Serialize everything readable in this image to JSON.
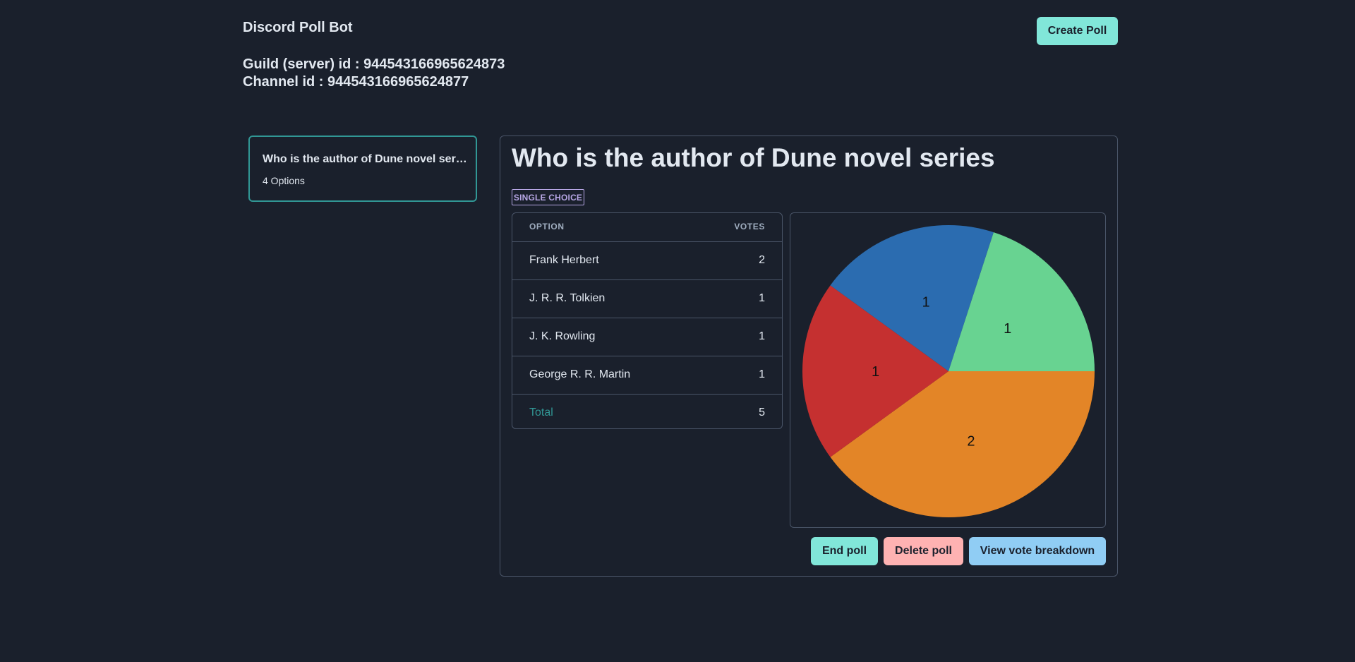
{
  "header": {
    "app_title": "Discord Poll Bot",
    "guild_line": "Guild (server) id : 944543166965624873",
    "channel_line": "Channel id : 944543166965624877",
    "create_poll_label": "Create Poll"
  },
  "sidebar": {
    "polls": [
      {
        "title": "Who is the author of Dune novel series",
        "subtitle": "4 Options"
      }
    ]
  },
  "poll": {
    "title": "Who is the author of Dune novel series",
    "badge": "SINGLE CHOICE",
    "table": {
      "col_option": "OPTION",
      "col_votes": "VOTES",
      "rows": [
        {
          "option": "Frank Herbert",
          "votes": "2"
        },
        {
          "option": "J. R. R. Tolkien",
          "votes": "1"
        },
        {
          "option": "J. K. Rowling",
          "votes": "1"
        },
        {
          "option": "George R. R. Martin",
          "votes": "1"
        }
      ],
      "total_label": "Total",
      "total_value": "5"
    },
    "actions": {
      "end_label": "End poll",
      "delete_label": "Delete poll",
      "breakdown_label": "View vote breakdown"
    }
  },
  "chart_data": {
    "type": "pie",
    "categories": [
      "Frank Herbert",
      "J. R. R. Tolkien",
      "J. K. Rowling",
      "George R. R. Martin"
    ],
    "values": [
      2,
      1,
      1,
      1
    ],
    "colors": [
      "#e38527",
      "#c53030",
      "#2b6cb0",
      "#68d391"
    ],
    "data_labels": [
      "2",
      "1",
      "1",
      "1"
    ]
  },
  "colors": {
    "background": "#1a202c",
    "accent_teal": "#81e6d9",
    "accent_red": "#feb2b2",
    "accent_blue": "#90cdf4",
    "selected_border": "#319795",
    "badge_purple": "#b7a7e5"
  }
}
